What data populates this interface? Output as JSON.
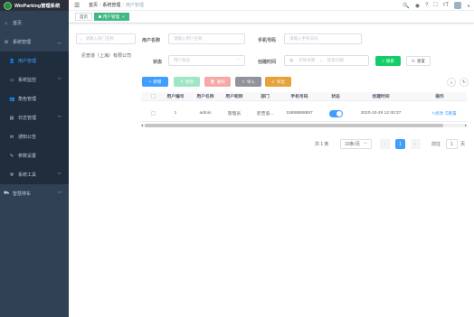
{
  "app": {
    "title": "WinParking管理系统"
  },
  "sidebar": {
    "items": [
      {
        "label": "首页",
        "icon": "home-icon"
      },
      {
        "label": "系统管理",
        "icon": "gear-icon"
      },
      {
        "label": "用户管理",
        "icon": "user-icon"
      },
      {
        "label": "系统监控",
        "icon": "monitor-icon"
      },
      {
        "label": "角色管理",
        "icon": "peoples-icon"
      },
      {
        "label": "日志管理",
        "icon": "log-icon"
      },
      {
        "label": "通知公告",
        "icon": "message-icon"
      },
      {
        "label": "参数设置",
        "icon": "edit-icon"
      },
      {
        "label": "系统工具",
        "icon": "tool-icon"
      },
      {
        "label": "智慧停车",
        "icon": "car-icon"
      }
    ]
  },
  "header": {
    "breadcrumb": [
      "首页",
      "系统管理",
      "用户管理"
    ]
  },
  "tags": {
    "home": "首页",
    "current": "用户管理"
  },
  "dept": {
    "search_placeholder": "请输入部门名称",
    "node": "尼普道（上海）有限公司"
  },
  "filters": {
    "username_label": "用户名称",
    "username_placeholder": "请输入用户名称",
    "phone_label": "手机号码",
    "phone_placeholder": "请输入手机号码",
    "status_label": "状态",
    "status_placeholder": "用户状态",
    "created_label": "创建时间",
    "start_placeholder": "开始日期",
    "range_sep": "-",
    "end_placeholder": "结束日期",
    "search_btn": "搜索",
    "reset_btn": "重置"
  },
  "toolbar": {
    "add": "新增",
    "edit": "修改",
    "delete": "删除",
    "import": "导入",
    "export": "导出"
  },
  "table": {
    "headers": [
      "用户编号",
      "用户名称",
      "用户昵称",
      "部门",
      "手机号码",
      "状态",
      "创建时间",
      "操作"
    ],
    "rows": [
      {
        "id": "1",
        "username": "admin",
        "nickname": "管理员",
        "dept": "尼普道...",
        "phone": "15888888887",
        "status": true,
        "created": "2020-10-29 12:40:37",
        "edit": "修改",
        "reset": "重置"
      }
    ]
  },
  "pagination": {
    "total": "共 1 条",
    "page_size": "10条/页",
    "page": "1",
    "goto_label": "前往",
    "goto_value": "1",
    "page_unit": "页"
  },
  "colors": {
    "sidebar_bg": "#304156",
    "primary": "#409eff",
    "tag_active": "#42b983"
  }
}
